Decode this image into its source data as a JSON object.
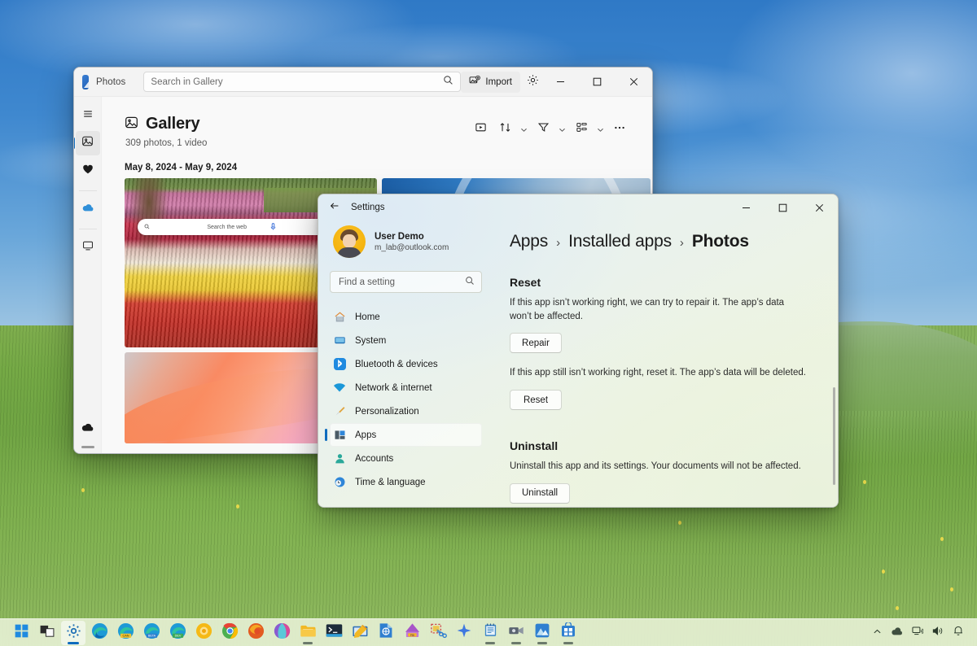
{
  "desktop": {
    "wallpaper_name": "bliss-wallpaper"
  },
  "photos": {
    "app_name": "Photos",
    "logo_icon": "photos-app-icon",
    "search": {
      "placeholder": "Search in Gallery",
      "value": "",
      "icon": "search-icon"
    },
    "import_label": "Import",
    "import_icon": "import-photos-icon",
    "settings_icon": "gear-icon",
    "window_controls": {
      "minimize": "minimize-icon",
      "maximize": "maximize-icon",
      "close": "close-icon"
    },
    "rail": [
      {
        "name": "hamburger-menu",
        "icon": "hamburger-icon",
        "active": false
      },
      {
        "name": "gallery",
        "icon": "gallery-icon",
        "active": true
      },
      {
        "name": "favorites",
        "icon": "heart-icon",
        "active": false
      },
      {
        "name": "onedrive",
        "icon": "cloud-icon",
        "active": false
      },
      {
        "name": "folders",
        "icon": "monitor-icon",
        "active": false
      },
      {
        "name": "icloud-photos",
        "icon": "cloud-filled-icon",
        "active": false
      }
    ],
    "gallery": {
      "title": "Gallery",
      "title_icon": "gallery-picture-icon",
      "subtitle": "309 photos, 1 video",
      "tools": [
        {
          "name": "slideshow",
          "icon": "slideshow-icon",
          "caret": false
        },
        {
          "name": "sort",
          "icon": "sort-icon",
          "caret": true
        },
        {
          "name": "filter",
          "icon": "filter-icon",
          "caret": true
        },
        {
          "name": "view-layout",
          "icon": "grid-layout-icon",
          "caret": true
        },
        {
          "name": "more-options",
          "icon": "ellipsis-icon",
          "caret": false
        }
      ],
      "date_group": "May 8, 2024 - May 9, 2024",
      "thumbnails": [
        {
          "name": "thumb-tulip-field",
          "overlay_search": "Search the web"
        },
        {
          "name": "thumb-blue-windows"
        },
        {
          "name": "thumb-pink-orange-gradient"
        }
      ]
    }
  },
  "settings": {
    "app_name": "Settings",
    "back_icon": "back-arrow-icon",
    "window_controls": {
      "minimize": "minimize-icon",
      "maximize": "maximize-icon",
      "close": "close-icon"
    },
    "profile": {
      "name": "User Demo",
      "email": "m_lab@outlook.com",
      "avatar": "user-avatar"
    },
    "find_setting": {
      "placeholder": "Find a setting",
      "value": "",
      "icon": "search-icon"
    },
    "nav_items": [
      {
        "label": "Home",
        "icon": "home-icon",
        "active": false
      },
      {
        "label": "System",
        "icon": "system-monitor-icon",
        "active": false
      },
      {
        "label": "Bluetooth & devices",
        "icon": "bluetooth-icon",
        "active": false
      },
      {
        "label": "Network & internet",
        "icon": "wifi-icon",
        "active": false
      },
      {
        "label": "Personalization",
        "icon": "paintbrush-icon",
        "active": false
      },
      {
        "label": "Apps",
        "icon": "apps-icon",
        "active": true
      },
      {
        "label": "Accounts",
        "icon": "accounts-person-icon",
        "active": false
      },
      {
        "label": "Time & language",
        "icon": "clock-globe-icon",
        "active": false
      }
    ],
    "breadcrumb": {
      "level1": "Apps",
      "level2": "Installed apps",
      "level3": "Photos",
      "separator": "›"
    },
    "reset_section": {
      "title": "Reset",
      "repair_text": "If this app isn’t working right, we can try to repair it. The app’s data won’t be affected.",
      "repair_button": "Repair",
      "reset_text": "If this app still isn’t working right, reset it. The app’s data will be deleted.",
      "reset_button": "Reset"
    },
    "uninstall_section": {
      "title": "Uninstall",
      "text": "Uninstall this app and its settings. Your documents will not be affected.",
      "button": "Uninstall"
    }
  },
  "taskbar": {
    "items": [
      {
        "name": "start-button",
        "icon": "windows-logo-icon",
        "running": false,
        "active": false
      },
      {
        "name": "task-view",
        "icon": "task-view-icon",
        "running": false,
        "active": false
      },
      {
        "name": "settings-taskbar",
        "icon": "gear-icon",
        "running": true,
        "active": true
      },
      {
        "name": "edge",
        "icon": "edge-icon",
        "running": false,
        "active": false
      },
      {
        "name": "edge-canary",
        "icon": "edge-canary-icon",
        "running": false,
        "active": false
      },
      {
        "name": "edge-beta",
        "icon": "edge-beta-icon",
        "running": false,
        "active": false
      },
      {
        "name": "edge-dev",
        "icon": "edge-dev-icon",
        "running": false,
        "active": false
      },
      {
        "name": "firefox-dev",
        "icon": "firefox-dev-icon",
        "running": false,
        "active": false
      },
      {
        "name": "chrome",
        "icon": "chrome-icon",
        "running": false,
        "active": false
      },
      {
        "name": "firefox",
        "icon": "firefox-icon",
        "running": false,
        "active": false
      },
      {
        "name": "opera",
        "icon": "opera-icon",
        "running": false,
        "active": false
      },
      {
        "name": "file-explorer",
        "icon": "folder-icon",
        "running": true,
        "active": false
      },
      {
        "name": "terminal",
        "icon": "terminal-icon",
        "running": false,
        "active": false
      },
      {
        "name": "powershell-ise",
        "icon": "powershell-ise-icon",
        "running": false,
        "active": false
      },
      {
        "name": "word",
        "icon": "word-doc-icon",
        "running": false,
        "active": false
      },
      {
        "name": "pbi",
        "icon": "power-bi-icon",
        "running": false,
        "active": false
      },
      {
        "name": "snipping-tool",
        "icon": "snipping-tool-icon",
        "running": false,
        "active": false
      },
      {
        "name": "copilot",
        "icon": "copilot-sparkle-icon",
        "running": false,
        "active": false
      },
      {
        "name": "notepad",
        "icon": "notepad-icon",
        "running": true,
        "active": false
      },
      {
        "name": "camera",
        "icon": "camera-icon",
        "running": true,
        "active": false
      },
      {
        "name": "photos-taskbar",
        "icon": "photos-app-icon",
        "running": true,
        "active": false
      },
      {
        "name": "microsoft-store",
        "icon": "store-icon",
        "running": true,
        "active": false
      }
    ],
    "tray": [
      {
        "name": "show-hidden-icons",
        "icon": "chevron-up-icon"
      },
      {
        "name": "onedrive-tray",
        "icon": "cloud-icon"
      },
      {
        "name": "network-tray",
        "icon": "network-icon"
      },
      {
        "name": "volume-tray",
        "icon": "speaker-icon"
      },
      {
        "name": "notifications-tray",
        "icon": "bell-icon"
      }
    ]
  }
}
